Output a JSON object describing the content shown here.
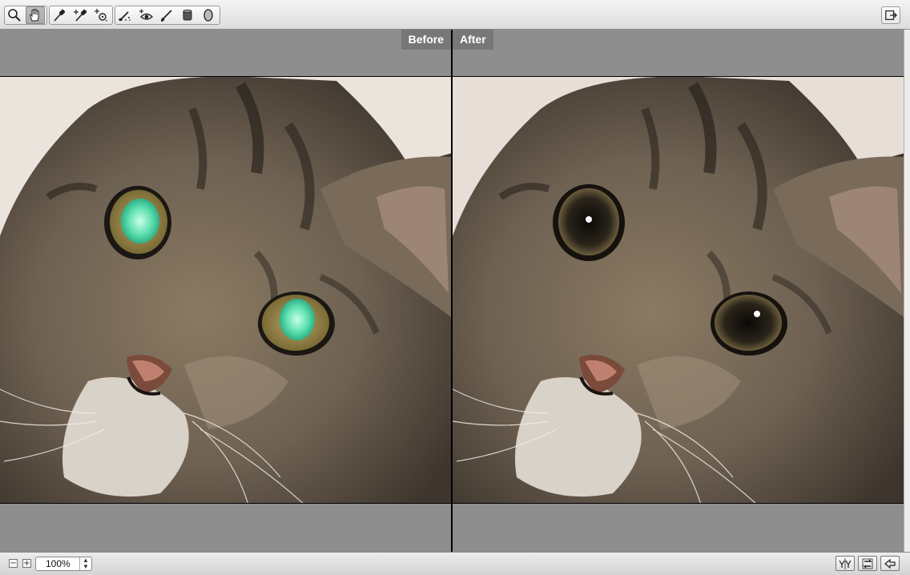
{
  "toolbar": {
    "tools": [
      {
        "name": "zoom-tool",
        "icon": "magnifier-icon",
        "active": false
      },
      {
        "name": "hand-tool",
        "icon": "hand-icon",
        "active": true
      },
      {
        "name": "eyedropper-tool",
        "icon": "eyedropper-icon",
        "active": false
      },
      {
        "name": "eyedropper-plus-tool",
        "icon": "eyedropper-plus-icon",
        "active": false
      },
      {
        "name": "sampler-tool",
        "icon": "target-plus-icon",
        "active": false
      },
      {
        "name": "retouch-brush-tool",
        "icon": "brush-sparkle-icon",
        "active": false
      },
      {
        "name": "red-eye-tool",
        "icon": "eye-plus-icon",
        "active": false
      },
      {
        "name": "brush-tool",
        "icon": "brush-icon",
        "active": false
      },
      {
        "name": "cylinder-tool",
        "icon": "cylinder-icon",
        "active": false
      },
      {
        "name": "ellipse-tool",
        "icon": "ellipse-icon",
        "active": false
      }
    ],
    "exit_icon": "exit-icon"
  },
  "panes": {
    "before_label": "Before",
    "after_label": "After"
  },
  "statusbar": {
    "zoom_out": "−",
    "zoom_in": "+",
    "zoom_value": "100%",
    "view_buttons": [
      "split-view-icon",
      "swap-icon",
      "back-icon"
    ]
  },
  "colors": {
    "pane_bg": "#8e8e8e",
    "label_bg": "#777777",
    "before_eye": "#5fe0b0",
    "after_eye": "#111111"
  }
}
